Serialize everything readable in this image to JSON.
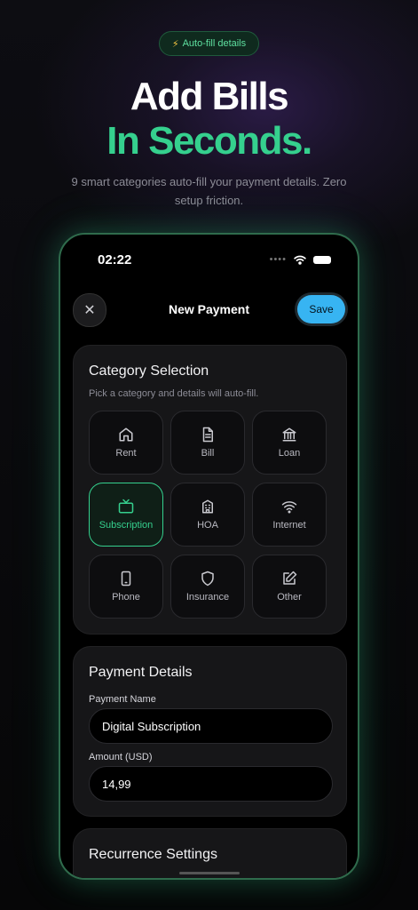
{
  "badge": {
    "icon": "lightning-icon",
    "label": "Auto-fill details"
  },
  "hero": {
    "line1": "Add Bills",
    "line2": "In Seconds.",
    "subtitle": "9 smart categories auto-fill your payment details. Zero setup friction."
  },
  "status_bar": {
    "time": "02:22"
  },
  "nav": {
    "title": "New Payment",
    "save_label": "Save"
  },
  "category_card": {
    "title": "Category Selection",
    "subtitle": "Pick a category and details will auto-fill.",
    "selected": "Subscription",
    "items": [
      {
        "label": "Rent",
        "icon": "home-icon"
      },
      {
        "label": "Bill",
        "icon": "document-icon"
      },
      {
        "label": "Loan",
        "icon": "bank-icon"
      },
      {
        "label": "Subscription",
        "icon": "tv-icon"
      },
      {
        "label": "HOA",
        "icon": "building-icon"
      },
      {
        "label": "Internet",
        "icon": "wifi-icon"
      },
      {
        "label": "Phone",
        "icon": "phone-icon"
      },
      {
        "label": "Insurance",
        "icon": "shield-icon"
      },
      {
        "label": "Other",
        "icon": "edit-icon"
      }
    ]
  },
  "payment_card": {
    "title": "Payment Details",
    "name_label": "Payment Name",
    "name_value": "Digital Subscription",
    "amount_label": "Amount (USD)",
    "amount_value": "14,99"
  },
  "recurrence_card": {
    "title": "Recurrence Settings"
  },
  "colors": {
    "accent_green": "#35d08e",
    "save_blue": "#37b4f2",
    "background": "#060607"
  }
}
